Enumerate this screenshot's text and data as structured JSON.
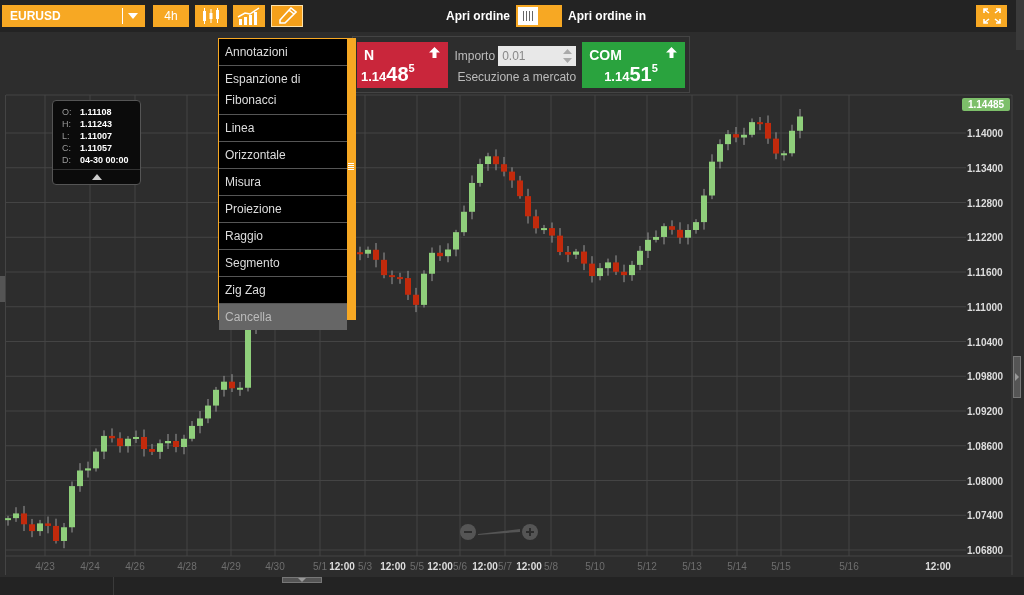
{
  "toolbar": {
    "symbol": "EURUSD",
    "timeframe": "4h",
    "tools": [
      {
        "kind": "candles",
        "selected": false
      },
      {
        "kind": "indicators",
        "selected": false
      },
      {
        "kind": "drawing",
        "selected": true
      }
    ],
    "order_label": "Apri ordine",
    "order_switch": {
      "on": false
    },
    "order_in_label": "Apri ordine in"
  },
  "trade_panel": {
    "sell": {
      "label": "N",
      "price_prefix": "1.14",
      "price_pips": "48",
      "price_fraction": "5"
    },
    "amount_label": "Importo",
    "amount": "0.01",
    "execution": "Esecuzione a mercato",
    "buy": {
      "label": "COM",
      "price_prefix": "1.14",
      "price_pips": "51",
      "price_fraction": "5"
    }
  },
  "drawing_menu": [
    {
      "label": "Annotazioni",
      "selected": false
    },
    {
      "label": "Espanzione di Fibonacci",
      "selected": false
    },
    {
      "label": "Linea",
      "selected": false
    },
    {
      "label": "Orizzontale",
      "selected": false
    },
    {
      "label": "Misura",
      "selected": false
    },
    {
      "label": "Proiezione",
      "selected": false
    },
    {
      "label": "Raggio",
      "selected": false
    },
    {
      "label": "Segmento",
      "selected": false
    },
    {
      "label": "Zig Zag",
      "selected": false
    },
    {
      "label": "Cancella",
      "selected": true
    }
  ],
  "ohlc_tooltip": [
    {
      "key": "O:",
      "value": "1.11108"
    },
    {
      "key": "H:",
      "value": "1.11243"
    },
    {
      "key": "L:",
      "value": "1.11007"
    },
    {
      "key": "C:",
      "value": "1.11057"
    },
    {
      "key": "D:",
      "value": "04-30 00:00"
    }
  ],
  "price_axis": [
    "1.14000",
    "1.13400",
    "1.12800",
    "1.12200",
    "1.11600",
    "1.11000",
    "1.10400",
    "1.09800",
    "1.09200",
    "1.08600",
    "1.08000",
    "1.07400",
    "1.06800"
  ],
  "current_price": "1.14485",
  "time_axis": [
    {
      "label": "4/23",
      "kind": "date"
    },
    {
      "label": "4/24",
      "kind": "date"
    },
    {
      "label": "4/26",
      "kind": "date"
    },
    {
      "label": "4/28",
      "kind": "date"
    },
    {
      "label": "4/29",
      "kind": "date"
    },
    {
      "label": "4/30",
      "kind": "date"
    },
    {
      "label": "5/1",
      "kind": "date"
    },
    {
      "label": "12:00",
      "kind": "time"
    },
    {
      "label": "5/3",
      "kind": "date"
    },
    {
      "label": "12:00",
      "kind": "time"
    },
    {
      "label": "5/5",
      "kind": "date"
    },
    {
      "label": "12:00",
      "kind": "time"
    },
    {
      "label": "5/6",
      "kind": "date"
    },
    {
      "label": "12:00",
      "kind": "time"
    },
    {
      "label": "5/7",
      "kind": "date"
    },
    {
      "label": "12:00",
      "kind": "time"
    },
    {
      "label": "5/8",
      "kind": "date"
    },
    {
      "label": "5/10",
      "kind": "date"
    },
    {
      "label": "5/12",
      "kind": "date"
    },
    {
      "label": "5/13",
      "kind": "date"
    },
    {
      "label": "5/14",
      "kind": "date"
    },
    {
      "label": "5/15",
      "kind": "date"
    },
    {
      "label": "5/16",
      "kind": "date"
    },
    {
      "label": "12:00",
      "kind": "time"
    }
  ]
}
